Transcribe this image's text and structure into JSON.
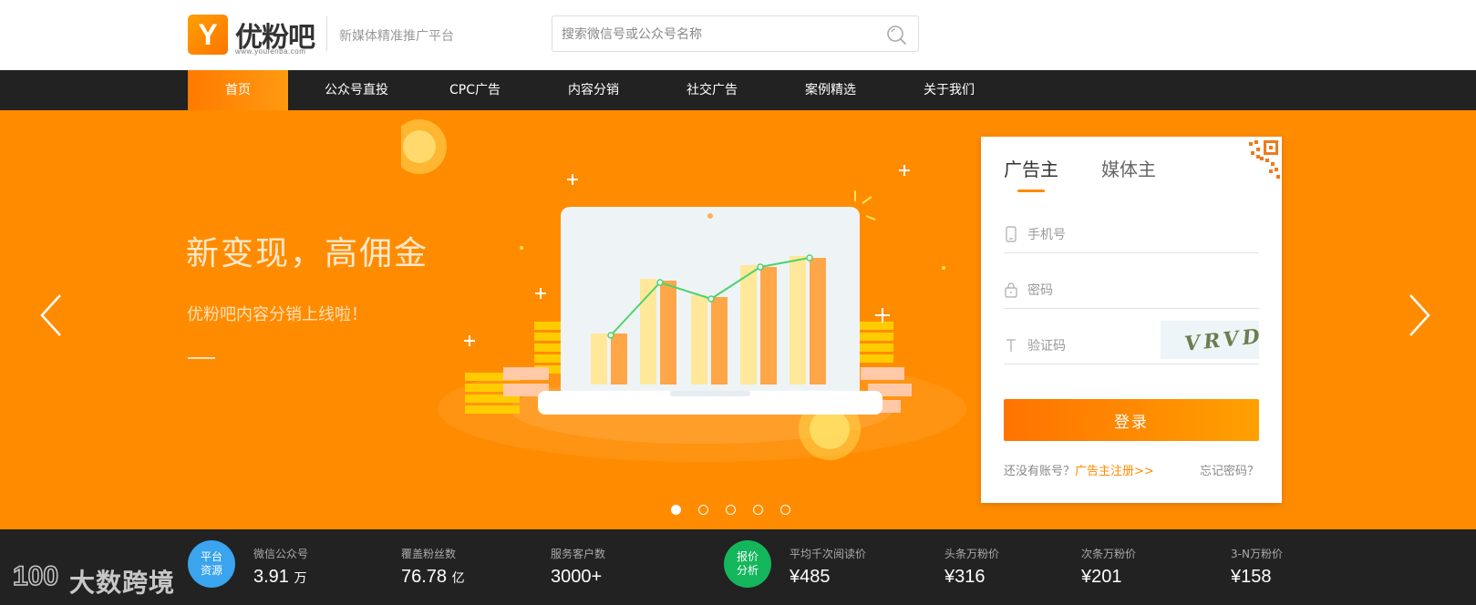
{
  "header": {
    "logo_mark": "Y",
    "logo_name": "优粉吧",
    "logo_url": "www.youfenba.com",
    "slogan": "新媒体精准推广平台",
    "search_placeholder": "搜索微信号或公众号名称",
    "search_icon": "search-icon"
  },
  "nav": {
    "items": [
      {
        "label": "首页",
        "active": true
      },
      {
        "label": "公众号直投"
      },
      {
        "label": "CPC广告"
      },
      {
        "label": "内容分销"
      },
      {
        "label": "社交广告"
      },
      {
        "label": "案例精选"
      },
      {
        "label": "关于我们"
      }
    ]
  },
  "banner": {
    "title": "新变现，高佣金",
    "subtitle": "优粉吧内容分销上线啦！",
    "background": "#ff8c00",
    "slide_count": 5,
    "active_slide": 0
  },
  "login": {
    "tabs": [
      "广告主",
      "媒体主"
    ],
    "active_tab": 0,
    "phone_placeholder": "手机号",
    "password_placeholder": "密码",
    "captcha_placeholder": "验证码",
    "captcha_text": "VRVD",
    "submit_label": "登录",
    "no_account_text": "还没有账号？",
    "register_link": "广告主注册>>",
    "forgot_link": "忘记密码？"
  },
  "stats": {
    "platform_badge": [
      "平台",
      "资源"
    ],
    "price_badge": [
      "报价",
      "分析"
    ],
    "items": [
      {
        "label": "微信公众号",
        "value": "3.91",
        "unit": "万"
      },
      {
        "label": "覆盖粉丝数",
        "value": "76.78",
        "unit": "亿"
      },
      {
        "label": "服务客户数",
        "value": "3000+",
        "unit": ""
      },
      {
        "label": "平均千次阅读价",
        "value": "¥485",
        "unit": ""
      },
      {
        "label": "头条万粉价",
        "value": "¥316",
        "unit": ""
      },
      {
        "label": "次条万粉价",
        "value": "¥201",
        "unit": ""
      },
      {
        "label": "3-N万粉价",
        "value": "¥158",
        "unit": ""
      }
    ]
  },
  "watermark": {
    "logo": "100",
    "text": "大数跨境"
  },
  "colors": {
    "accent": "#ff8a00",
    "nav_bg": "#222222",
    "badge_blue": "#3aa4ee",
    "badge_green": "#14b65c"
  }
}
